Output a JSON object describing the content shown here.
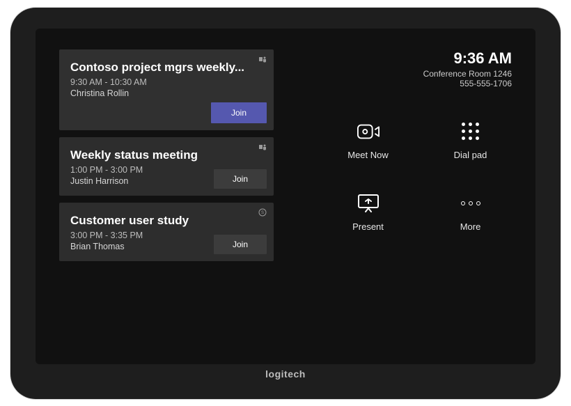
{
  "header": {
    "time": "9:36 AM",
    "room": "Conference Room 1246",
    "phone": "555-555-1706"
  },
  "meetings": [
    {
      "title": "Contoso project mgrs weekly...",
      "time": "9:30 AM - 10:30 AM",
      "organizer": "Christina Rollin",
      "join_label": "Join",
      "current": true,
      "app_icon": "teams"
    },
    {
      "title": "Weekly status meeting",
      "time": "1:00 PM - 3:00 PM",
      "organizer": "Justin Harrison",
      "join_label": "Join",
      "current": false,
      "app_icon": "teams"
    },
    {
      "title": "Customer user study",
      "time": "3:00 PM - 3:35 PM",
      "organizer": "Brian Thomas",
      "join_label": "Join",
      "current": false,
      "app_icon": "skype"
    }
  ],
  "actions": {
    "meet_now": "Meet Now",
    "dial_pad": "Dial pad",
    "present": "Present",
    "more": "More"
  },
  "brand": "logitech"
}
